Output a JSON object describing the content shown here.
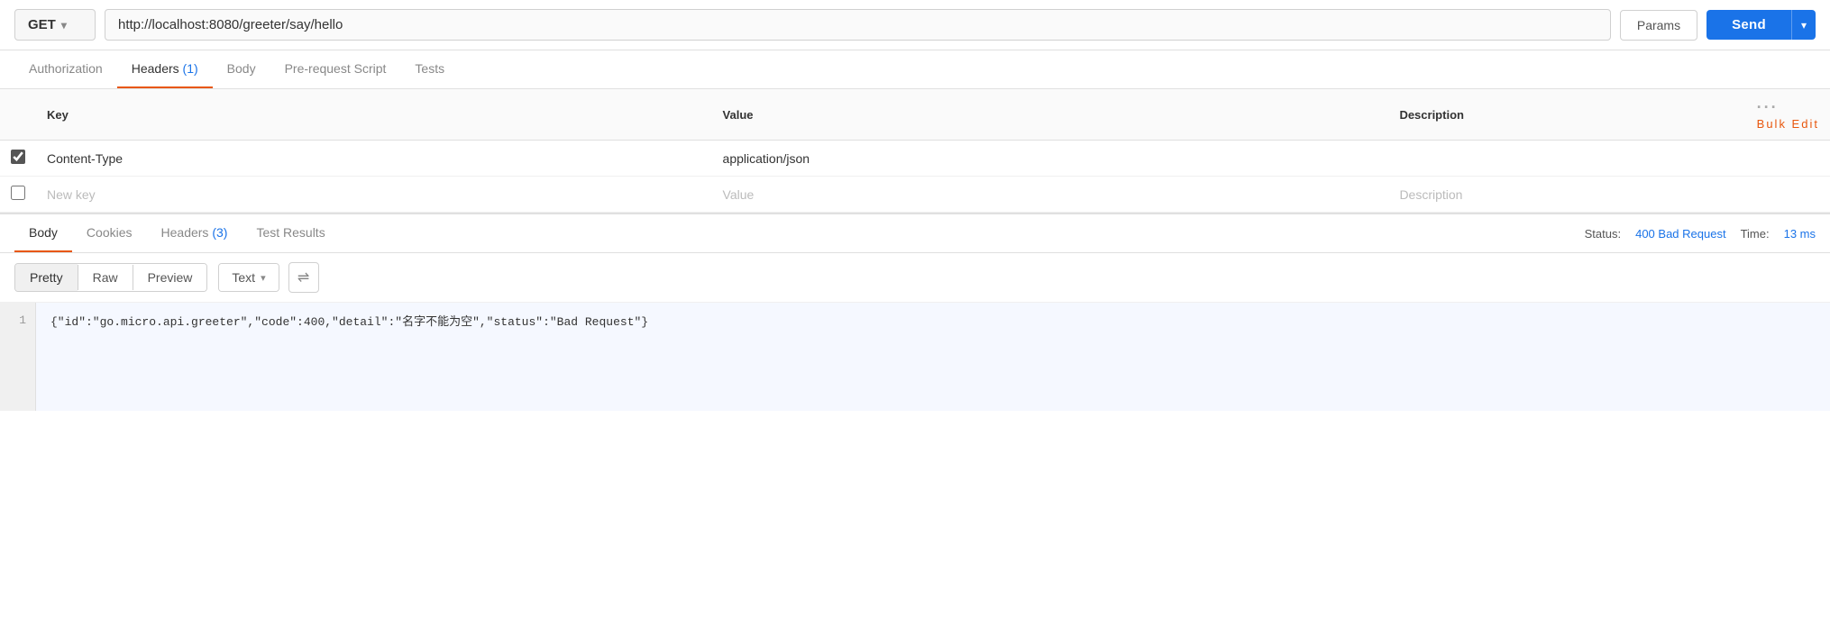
{
  "topbar": {
    "method": "GET",
    "method_chevron": "▾",
    "url": "http://localhost:8080/greeter/say/hello",
    "params_label": "Params",
    "send_label": "Send",
    "send_dropdown_icon": "▾"
  },
  "request_tabs": [
    {
      "id": "authorization",
      "label": "Authorization",
      "active": false
    },
    {
      "id": "headers",
      "label": "Headers",
      "badge": "(1)",
      "active": true
    },
    {
      "id": "body",
      "label": "Body",
      "active": false
    },
    {
      "id": "prerequest",
      "label": "Pre-request Script",
      "active": false
    },
    {
      "id": "tests",
      "label": "Tests",
      "active": false
    }
  ],
  "headers_table": {
    "columns": [
      {
        "id": "key",
        "label": "Key"
      },
      {
        "id": "value",
        "label": "Value"
      },
      {
        "id": "description",
        "label": "Description"
      },
      {
        "id": "actions",
        "label": "···"
      }
    ],
    "bulk_edit_label": "Bulk Edit",
    "rows": [
      {
        "checked": true,
        "key": "Content-Type",
        "value": "application/json",
        "description": ""
      }
    ],
    "placeholder_row": {
      "key_placeholder": "New key",
      "value_placeholder": "Value",
      "description_placeholder": "Description"
    }
  },
  "response_tabs": [
    {
      "id": "body",
      "label": "Body",
      "active": true
    },
    {
      "id": "cookies",
      "label": "Cookies",
      "active": false
    },
    {
      "id": "headers",
      "label": "Headers",
      "badge": "(3)",
      "active": false
    },
    {
      "id": "test_results",
      "label": "Test Results",
      "active": false
    }
  ],
  "response_status": {
    "status_label": "Status:",
    "status_value": "400 Bad Request",
    "time_label": "Time:",
    "time_value": "13 ms"
  },
  "body_toolbar": {
    "format_options": [
      {
        "id": "pretty",
        "label": "Pretty",
        "active": true
      },
      {
        "id": "raw",
        "label": "Raw",
        "active": false
      },
      {
        "id": "preview",
        "label": "Preview",
        "active": false
      }
    ],
    "type_label": "Text",
    "type_chevron": "▾",
    "wrap_icon": "⇌"
  },
  "code_view": {
    "line_number": "1",
    "content": "{\"id\":\"go.micro.api.greeter\",\"code\":400,\"detail\":\"名字不能为空\",\"status\":\"Bad Request\"}"
  }
}
